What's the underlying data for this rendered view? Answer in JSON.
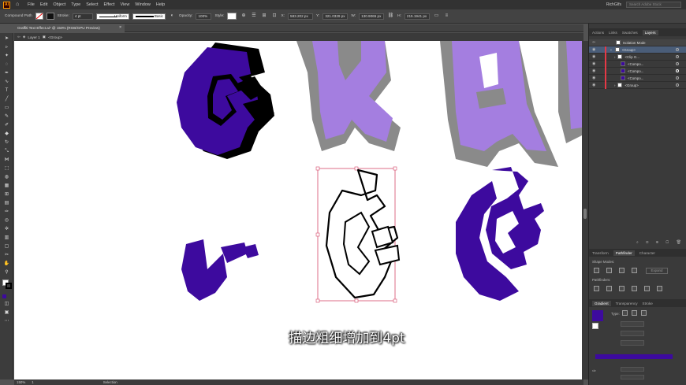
{
  "menubar": {
    "logo": "Ai",
    "items": [
      "File",
      "Edit",
      "Object",
      "Type",
      "Select",
      "Effect",
      "View",
      "Window",
      "Help"
    ],
    "user": "RichGIfs",
    "search_placeholder": "Search Adobe Stock"
  },
  "control": {
    "selection_type": "Compound Path",
    "stroke_label": "Stroke:",
    "stroke_value": "4 pt",
    "profile_value": "Uniform",
    "brush_value": "Basic",
    "opacity_label": "Opacity:",
    "opacity_value": "100%",
    "style_label": "Style:",
    "x_label": "X:",
    "x_value": "583.202 px",
    "y_label": "Y:",
    "y_value": "321.0329 px",
    "w_label": "W:",
    "w_value": "130.9065 px",
    "h_label": "H:",
    "h_value": "215.1941 px"
  },
  "document": {
    "tab_title": "Graffiti Text Effect.ai* @ 150% (RGB/GPU Preview)",
    "breadcrumb_layer": "Layer 1",
    "breadcrumb_group": "<Group>"
  },
  "layers_panel": {
    "tabs": [
      "Actions",
      "Links",
      "Swatches",
      "Layers"
    ],
    "active_tab": "Layers",
    "isolation": "Isolation Mode",
    "rows": [
      "<Group>",
      "<Clip G...",
      "<Compo...",
      "<Compo...",
      "<Compo...",
      "<Group>"
    ]
  },
  "pathfinder_panel": {
    "tabs": [
      "Transform",
      "Pathfinder",
      "Character"
    ],
    "active_tab": "Pathfinder",
    "shape_modes": "Shape Modes:",
    "pathfinders": "Pathfinders:",
    "expand": "Expand"
  },
  "gradient_panel": {
    "tabs": [
      "Gradient",
      "Transparency",
      "Stroke"
    ],
    "active_tab": "Gradient",
    "type_label": "Type:",
    "fill_color": "#3d0a9e"
  },
  "status": {
    "zoom": "150%",
    "page": "1",
    "tool": "Selection"
  },
  "subtitle": "描边粗细增加到4pt",
  "colors": {
    "dark_purple": "#3d0a9e",
    "light_purple": "#a47ee0",
    "shadow_gray": "#8a8a8a",
    "selection": "#d64a6a"
  }
}
